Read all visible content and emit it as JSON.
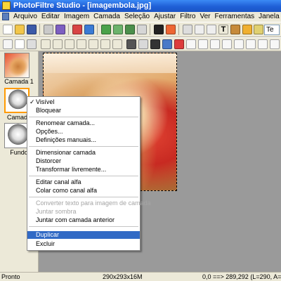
{
  "window": {
    "title": "PhotoFiltre Studio - [imagembola.jpg]"
  },
  "menubar": {
    "items": [
      "Arquivo",
      "Editar",
      "Imagem",
      "Camada",
      "Seleção",
      "Ajustar",
      "Filtro",
      "Ver",
      "Ferramentas",
      "Janela",
      "?"
    ]
  },
  "toolbar": {
    "zoom_value": "Te"
  },
  "layers": [
    {
      "label": "Camada 1"
    },
    {
      "label": "Camada"
    },
    {
      "label": "Fundo"
    }
  ],
  "context_menu": {
    "items": [
      {
        "label": "Visível",
        "checked": true
      },
      {
        "label": "Bloquear"
      },
      {
        "label": "Renomear camada..."
      },
      {
        "label": "Opções..."
      },
      {
        "label": "Definições manuais..."
      },
      {
        "label": "Dimensionar camada"
      },
      {
        "label": "Distorcer"
      },
      {
        "label": "Transformar livremente..."
      },
      {
        "label": "Editar canal alfa"
      },
      {
        "label": "Colar como canal alfa"
      },
      {
        "label": "Converter texto para imagem de camada",
        "disabled": true
      },
      {
        "label": "Juntar sombra",
        "disabled": true
      },
      {
        "label": "Juntar com camada anterior"
      },
      {
        "label": "Duplicar",
        "highlighted": true
      },
      {
        "label": "Excluir"
      }
    ]
  },
  "status": {
    "state": "Pronto",
    "size": "290x293x16M",
    "coords": "0,0 ==> 289,292 (L=290, A=293)"
  },
  "colors": {
    "highlight": "#316ac5",
    "title_blue": "#1f5fd6",
    "selected_layer_border": "#ff9a00"
  }
}
